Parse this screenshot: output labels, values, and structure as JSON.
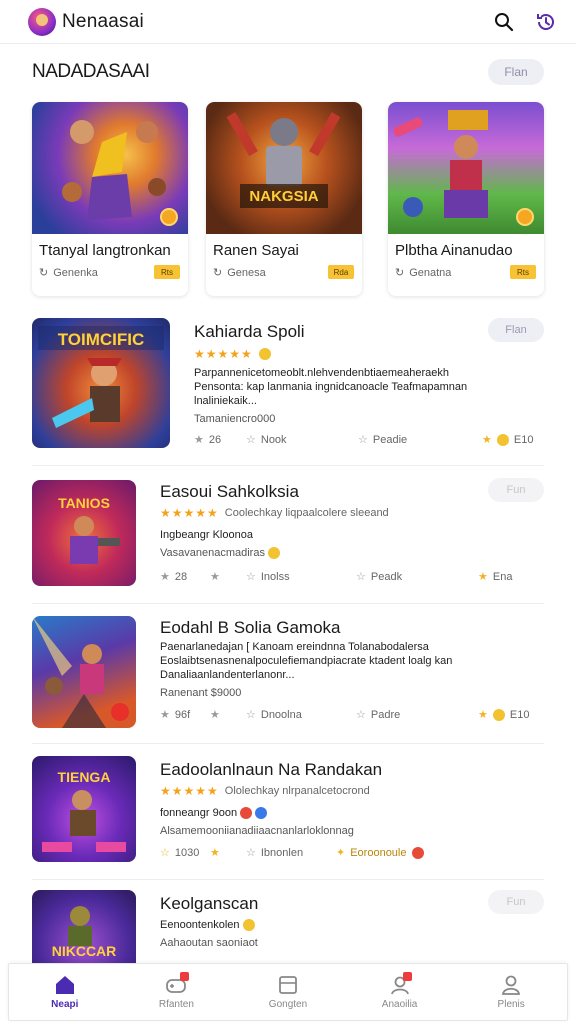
{
  "app": {
    "title": "Nenaasai"
  },
  "section": {
    "title": "NADADASAAI",
    "pill": "Flan"
  },
  "featured": [
    {
      "title": "Ttanyal langtronkan",
      "meta": "Genenka",
      "badge": "Rts"
    },
    {
      "title": "Ranen Sayai",
      "meta": "Genesa",
      "badge": "Rda"
    },
    {
      "title": "Plbtha Ainanudao",
      "meta": "Genatna",
      "badge": "Rts"
    }
  ],
  "games": [
    {
      "title": "Kahiarda Spoli",
      "pill": "Flan",
      "stars": "★★★★★",
      "rating_note": "",
      "desc_lines": [
        "Parpannenicetomeoblt.nlehvendenbtiaemeaheraekh",
        "Pensonta: kap lanmania ingnidcanoacle Teafmapamnan",
        "lnaliniekaik..."
      ],
      "sub": "Tamaniencro000",
      "stats": [
        "26",
        "Nook",
        "Peadie",
        "E10"
      ]
    },
    {
      "title": "Easoui Sahkolksia",
      "pill": "Fun",
      "stars": "★★★★★",
      "rating_note": "Coolechkay liqpaalcolere sleeand",
      "desc_lines": [
        "Ingbeangr Kloonoa"
      ],
      "sub": "Vasavanenacmadiras",
      "stats": [
        "28",
        "Inolss",
        "Peadk",
        "Ena"
      ]
    },
    {
      "title": "Eodahl B Solia Gamoka",
      "pill": "",
      "stars": "",
      "rating_note": "",
      "desc_lines": [
        "Paenarlanedajan  [ Kanoam ereindnna Tolanabodalersa",
        "Eoslaibtsenasnenalpoculefiemandpiacrate ktadent loalg kan",
        "Danaliaanlandenterlanonr..."
      ],
      "sub": "Ranenant $9000",
      "stats": [
        "96f",
        "Dnoolna",
        "Padre",
        "E10"
      ]
    },
    {
      "title": "Eadoolanlnaun Na Randakan",
      "pill": "",
      "stars": "★★★★★",
      "rating_note": "Ololechkay nlrpanalcetocrond",
      "desc_lines": [
        "fonneangr 9oon"
      ],
      "sub": "Alsamemooniianadiiaacnanlarloklonnag",
      "stats": [
        "1030",
        "Ibnonlen",
        "Eoroonoule"
      ]
    },
    {
      "title": "Keolganscan",
      "pill": "Fun",
      "stars": "",
      "rating_note": "",
      "desc_lines": [
        "Eenoontenkolen"
      ],
      "sub": "Aahaoutan saoniaot",
      "stats": []
    }
  ],
  "nav": [
    {
      "label": "Neapi"
    },
    {
      "label": "Rfanten"
    },
    {
      "label": "Gongten"
    },
    {
      "label": "Anaoilia"
    },
    {
      "label": "Plenis"
    }
  ],
  "colors": {
    "accent": "#4c2bb3",
    "star": "#f4a21c",
    "badge": "#f7c233"
  }
}
